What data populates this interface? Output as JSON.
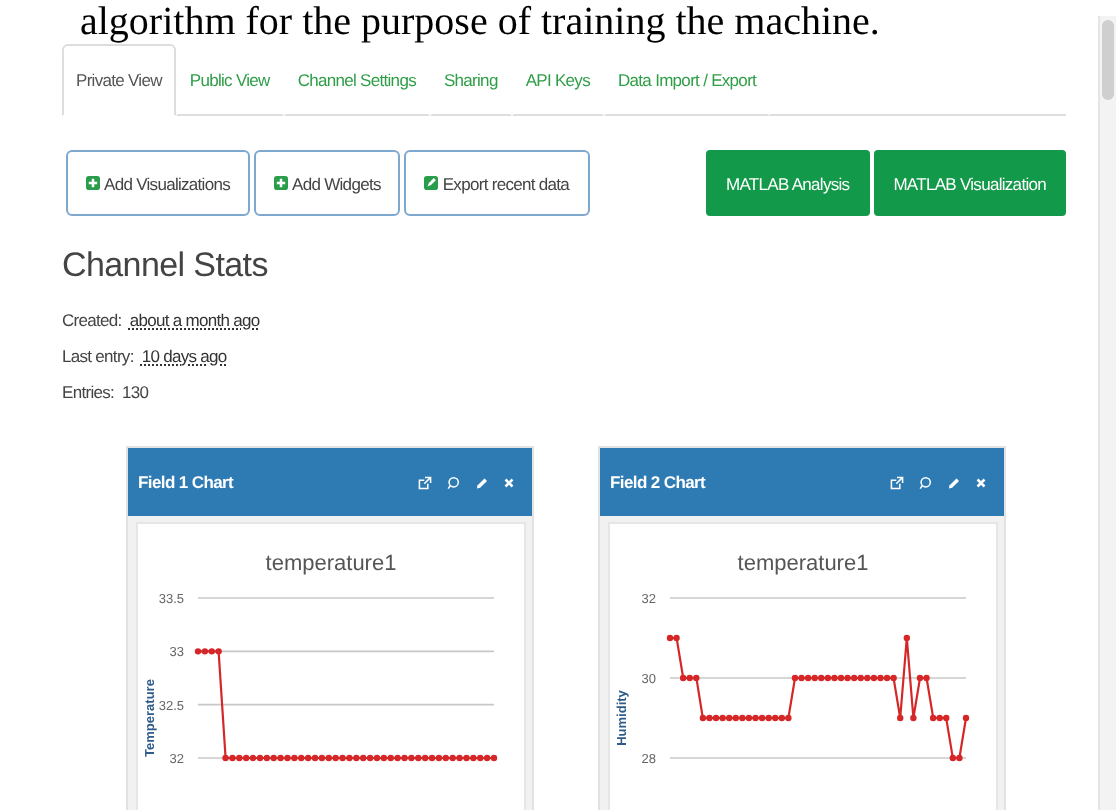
{
  "document_text": "algorithm for the purpose of training the machine.",
  "tabs": [
    {
      "label": "Private View",
      "selected": true
    },
    {
      "label": "Public View",
      "selected": false
    },
    {
      "label": "Channel Settings",
      "selected": false
    },
    {
      "label": "Sharing",
      "selected": false
    },
    {
      "label": "API Keys",
      "selected": false
    },
    {
      "label": "Data Import / Export",
      "selected": false
    }
  ],
  "left_buttons": [
    {
      "label": "Add Visualizations",
      "kind": "add"
    },
    {
      "label": "Add Widgets",
      "kind": "add"
    },
    {
      "label": "Export recent data",
      "kind": "export"
    }
  ],
  "right_buttons": [
    "MATLAB Analysis",
    "MATLAB Visualization"
  ],
  "stats": {
    "heading": "Channel Stats",
    "rows": [
      {
        "label": "Created:",
        "value": "about a month ago",
        "link": true
      },
      {
        "label": "Last entry:",
        "value": "10 days ago",
        "link": true
      },
      {
        "label": "Entries:",
        "value": "130",
        "link": false
      }
    ]
  },
  "cards": [
    {
      "title": "Field 1 Chart",
      "chart_data": {
        "type": "line",
        "title": "temperature1",
        "ylabel": "Temperature",
        "ylim": [
          32,
          33.5
        ],
        "yticks": [
          32,
          32.5,
          33,
          33.5
        ],
        "series": [
          {
            "color": "#d62728",
            "marker": "circle",
            "values": [
              33,
              33,
              33,
              33,
              32,
              32,
              32,
              32,
              32,
              32,
              32,
              32,
              32,
              32,
              32,
              32,
              32,
              32,
              32,
              32,
              32,
              32,
              32,
              32,
              32,
              32,
              32,
              32,
              32,
              32,
              32,
              32,
              32,
              32,
              32,
              32,
              32,
              32,
              32,
              32,
              32,
              32,
              32,
              32
            ]
          }
        ]
      }
    },
    {
      "title": "Field 2 Chart",
      "chart_data": {
        "type": "line",
        "title": "temperature1",
        "ylabel": "Humidity",
        "ylim": [
          28,
          32
        ],
        "yticks": [
          28,
          30,
          32
        ],
        "series": [
          {
            "color": "#d62728",
            "marker": "circle",
            "values": [
              31,
              31,
              30,
              30,
              30,
              29,
              29,
              29,
              29,
              29,
              29,
              29,
              29,
              29,
              29,
              29,
              29,
              29,
              29,
              30,
              30,
              30,
              30,
              30,
              30,
              30,
              30,
              30,
              30,
              30,
              30,
              30,
              30,
              30,
              30,
              29,
              31,
              29,
              30,
              30,
              29,
              29,
              29,
              28,
              28,
              29
            ]
          }
        ]
      }
    }
  ]
}
